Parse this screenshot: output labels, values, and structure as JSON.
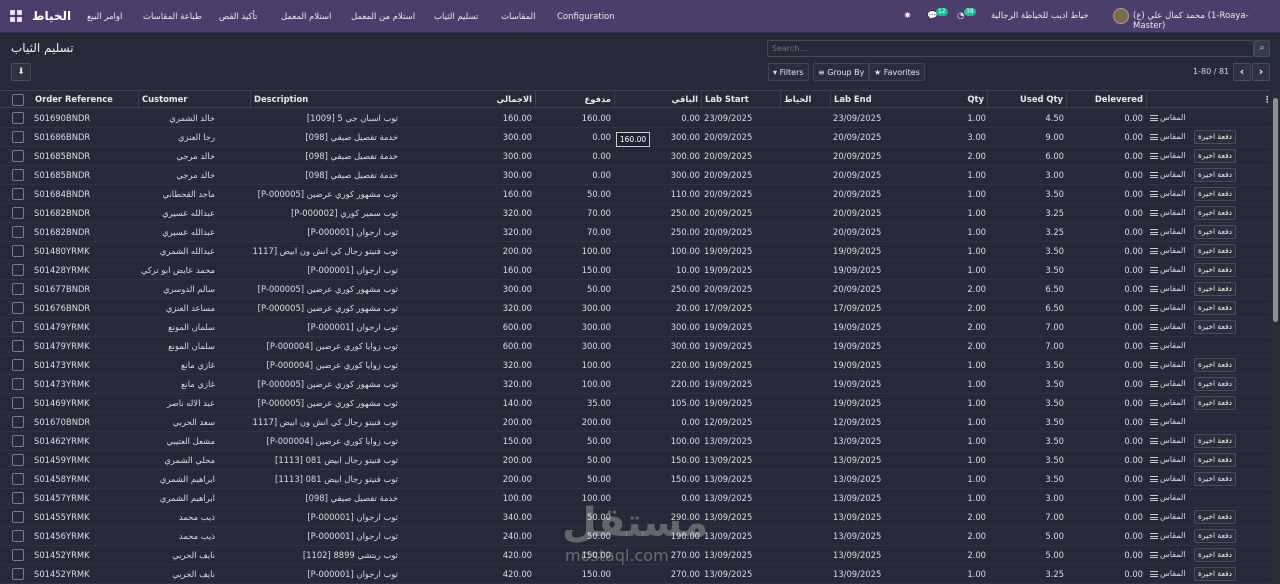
{
  "topbar": {
    "brand": "الخياط",
    "menu": [
      "اوامر البيع",
      "طباعة المقاسات",
      "تأكيد القص",
      "استلام المعمل",
      "استلام من المعمل",
      "تسليم الثياب",
      "المقاسات",
      "Configuration"
    ],
    "company": "خياط اديب للخياطة الرجالية",
    "user": "محمد كمال علي (ع) (1-Roaya-Master)",
    "chat_count": "12",
    "activity_count": "38",
    "icons": [
      "apps-icon",
      "bug-icon",
      "chat-icon",
      "clock-icon"
    ]
  },
  "page": {
    "title": "تسليم الثياب",
    "download_icon": "download-icon"
  },
  "search": {
    "placeholder": "Search...",
    "icon": "search-icon"
  },
  "filters": {
    "filters": "Filters",
    "group_by": "Group By",
    "favorites": "Favorites"
  },
  "pager": {
    "text": "1-80 / 81",
    "prev": "‹",
    "next": "›"
  },
  "tooltip": "160.00",
  "columns": {
    "order": "Order Reference",
    "customer": "Customer",
    "desc": "Description",
    "total": "الاجمالي",
    "paid": "مدفوع",
    "remain": "الباقي",
    "lab_start": "Lab Start",
    "tailor": "الخياط",
    "lab_end": "Lab End",
    "qty": "Qty",
    "used": "Used Qty",
    "delivered": "Delevered"
  },
  "labels": {
    "measure": "المقاس",
    "pay": "دفعة اخيرة"
  },
  "rows": [
    {
      "order": "S01690BNDR",
      "customer": "خالد الشمري",
      "desc": "ثوب اسبان جي 5 [1009]",
      "total": "160.00",
      "paid": "160.00",
      "remain": "0.00",
      "start": "23/09/2025",
      "end": "23/09/2025",
      "qty": "1.00",
      "used": "4.50",
      "deliv": "0.00",
      "pay": false
    },
    {
      "order": "S01686BNDR",
      "customer": "رجا العنزي",
      "desc": "خدمة تفصيل صيفي [098]",
      "total": "300.00",
      "paid": "0.00",
      "remain": "300.00",
      "start": "20/09/2025",
      "end": "20/09/2025",
      "qty": "3.00",
      "used": "9.00",
      "deliv": "0.00",
      "pay": true
    },
    {
      "order": "S01685BNDR",
      "customer": "خالد مرجي",
      "desc": "خدمة تفصيل صيفي [098]",
      "total": "300.00",
      "paid": "0.00",
      "remain": "300.00",
      "start": "20/09/2025",
      "end": "20/09/2025",
      "qty": "2.00",
      "used": "6.00",
      "deliv": "0.00",
      "pay": true
    },
    {
      "order": "S01685BNDR",
      "customer": "خالد مرجي",
      "desc": "خدمة تفصيل صيفي [098]",
      "total": "300.00",
      "paid": "0.00",
      "remain": "300.00",
      "start": "20/09/2025",
      "end": "20/09/2025",
      "qty": "1.00",
      "used": "3.00",
      "deliv": "0.00",
      "pay": true
    },
    {
      "order": "S01684BNDR",
      "customer": "ماجد القحطاني",
      "desc": "ثوب مشهور كوري عرضين [P-000005]",
      "total": "160.00",
      "paid": "50.00",
      "remain": "110.00",
      "start": "20/09/2025",
      "end": "20/09/2025",
      "qty": "1.00",
      "used": "3.50",
      "deliv": "0.00",
      "pay": true
    },
    {
      "order": "S01682BNDR",
      "customer": "عبدالله عسيري",
      "desc": "ثوب سمير كوري [P-000002]",
      "total": "320.00",
      "paid": "70.00",
      "remain": "250.00",
      "start": "20/09/2025",
      "end": "20/09/2025",
      "qty": "1.00",
      "used": "3.25",
      "deliv": "0.00",
      "pay": true
    },
    {
      "order": "S01682BNDR",
      "customer": "عبدالله عسيري",
      "desc": "ثوب ارجوان [P-000001]",
      "total": "320.00",
      "paid": "70.00",
      "remain": "250.00",
      "start": "20/09/2025",
      "end": "20/09/2025",
      "qty": "1.00",
      "used": "3.25",
      "deliv": "0.00",
      "pay": true
    },
    {
      "order": "S01480YRMK",
      "customer": "عبدالله الشمري",
      "desc": "ثوب فنيتو رجال كي انش ون ابيض [1117]",
      "total": "200.00",
      "paid": "100.00",
      "remain": "100.00",
      "start": "19/09/2025",
      "end": "19/09/2025",
      "qty": "1.00",
      "used": "3.50",
      "deliv": "0.00",
      "pay": true
    },
    {
      "order": "S01428YRMK",
      "customer": "محمد عايض ابو تركي",
      "desc": "ثوب ارجوان [P-000001]",
      "total": "160.00",
      "paid": "150.00",
      "remain": "10.00",
      "start": "19/09/2025",
      "end": "19/09/2025",
      "qty": "1.00",
      "used": "3.50",
      "deliv": "0.00",
      "pay": true
    },
    {
      "order": "S01677BNDR",
      "customer": "سالم الدوسري",
      "desc": "ثوب مشهور كوري عرضين [P-000005]",
      "total": "300.00",
      "paid": "50.00",
      "remain": "250.00",
      "start": "20/09/2025",
      "end": "20/09/2025",
      "qty": "2.00",
      "used": "6.50",
      "deliv": "0.00",
      "pay": true
    },
    {
      "order": "S01676BNDR",
      "customer": "مساعد العنزي",
      "desc": "ثوب مشهور كوري عرضين [P-000005]",
      "total": "320.00",
      "paid": "300.00",
      "remain": "20.00",
      "start": "17/09/2025",
      "end": "17/09/2025",
      "qty": "2.00",
      "used": "6.50",
      "deliv": "0.00",
      "pay": true
    },
    {
      "order": "S01479YRMK",
      "customer": "سلمان المونع",
      "desc": "ثوب ارجوان [P-000001]",
      "total": "600.00",
      "paid": "300.00",
      "remain": "300.00",
      "start": "19/09/2025",
      "end": "19/09/2025",
      "qty": "2.00",
      "used": "7.00",
      "deliv": "0.00",
      "pay": true
    },
    {
      "order": "S01479YRMK",
      "customer": "سلمان المونع",
      "desc": "ثوب زوايا كوري عرضين [P-000004]",
      "total": "600.00",
      "paid": "300.00",
      "remain": "300.00",
      "start": "19/09/2025",
      "end": "19/09/2025",
      "qty": "2.00",
      "used": "7.00",
      "deliv": "0.00",
      "pay": false
    },
    {
      "order": "S01473YRMK",
      "customer": "غازي مانع",
      "desc": "ثوب زوايا كوري عرضين [P-000004]",
      "total": "320.00",
      "paid": "100.00",
      "remain": "220.00",
      "start": "19/09/2025",
      "end": "19/09/2025",
      "qty": "1.00",
      "used": "3.50",
      "deliv": "0.00",
      "pay": true
    },
    {
      "order": "S01473YRMK",
      "customer": "غازي مانع",
      "desc": "ثوب مشهور كوري عرضين [P-000005]",
      "total": "320.00",
      "paid": "100.00",
      "remain": "220.00",
      "start": "19/09/2025",
      "end": "19/09/2025",
      "qty": "1.00",
      "used": "3.50",
      "deliv": "0.00",
      "pay": true
    },
    {
      "order": "S01469YRMK",
      "customer": "عبد الاله ناصر",
      "desc": "ثوب مشهور كوري عرضين [P-000005]",
      "total": "140.00",
      "paid": "35.00",
      "remain": "105.00",
      "start": "19/09/2025",
      "end": "19/09/2025",
      "qty": "1.00",
      "used": "3.50",
      "deliv": "0.00",
      "pay": true
    },
    {
      "order": "S01670BNDR",
      "customer": "سعد الحربي",
      "desc": "ثوب فنيتو رجال كي انش ون ابيض [1117]",
      "total": "200.00",
      "paid": "200.00",
      "remain": "0.00",
      "start": "12/09/2025",
      "end": "12/09/2025",
      "qty": "1.00",
      "used": "3.50",
      "deliv": "0.00",
      "pay": false
    },
    {
      "order": "S01462YRMK",
      "customer": "مشعل العتيبي",
      "desc": "ثوب زوايا كوري عرضين [P-000004]",
      "total": "150.00",
      "paid": "50.00",
      "remain": "100.00",
      "start": "13/09/2025",
      "end": "13/09/2025",
      "qty": "1.00",
      "used": "3.50",
      "deliv": "0.00",
      "pay": true
    },
    {
      "order": "S01459YRMK",
      "customer": "محلي الشمري",
      "desc": "ثوب فنيتو رجال ابيض 081 [1113]",
      "total": "200.00",
      "paid": "50.00",
      "remain": "150.00",
      "start": "13/09/2025",
      "end": "13/09/2025",
      "qty": "1.00",
      "used": "3.50",
      "deliv": "0.00",
      "pay": true
    },
    {
      "order": "S01458YRMK",
      "customer": "ابراهيم الشمري",
      "desc": "ثوب فنيتو رجال ابيض 081 [1113]",
      "total": "200.00",
      "paid": "50.00",
      "remain": "150.00",
      "start": "13/09/2025",
      "end": "13/09/2025",
      "qty": "1.00",
      "used": "3.50",
      "deliv": "0.00",
      "pay": true
    },
    {
      "order": "S01457YRMK",
      "customer": "ابراهيم الشمري",
      "desc": "خدمة تفصيل صيفي [098]",
      "total": "100.00",
      "paid": "100.00",
      "remain": "0.00",
      "start": "13/09/2025",
      "end": "13/09/2025",
      "qty": "1.00",
      "used": "3.00",
      "deliv": "0.00",
      "pay": false
    },
    {
      "order": "S01455YRMK",
      "customer": "ذيب محمد",
      "desc": "ثوب ارجوان [P-000001]",
      "total": "340.00",
      "paid": "50.00",
      "remain": "290.00",
      "start": "13/09/2025",
      "end": "13/09/2025",
      "qty": "2.00",
      "used": "7.00",
      "deliv": "0.00",
      "pay": true
    },
    {
      "order": "S01456YRMK",
      "customer": "ذيب محمد",
      "desc": "ثوب ارجوان [P-000001]",
      "total": "240.00",
      "paid": "50.00",
      "remain": "190.00",
      "start": "13/09/2025",
      "end": "13/09/2025",
      "qty": "2.00",
      "used": "5.00",
      "deliv": "0.00",
      "pay": true
    },
    {
      "order": "S01452YRMK",
      "customer": "نايف الحربي",
      "desc": "ثوب ريتشي 8899 [1102]",
      "total": "420.00",
      "paid": "150.00",
      "remain": "270.00",
      "start": "13/09/2025",
      "end": "13/09/2025",
      "qty": "2.00",
      "used": "5.00",
      "deliv": "0.00",
      "pay": true
    },
    {
      "order": "S01452YRMK",
      "customer": "نايف الحربي",
      "desc": "ثوب ارجوان [P-000001]",
      "total": "420.00",
      "paid": "150.00",
      "remain": "270.00",
      "start": "13/09/2025",
      "end": "13/09/2025",
      "qty": "1.00",
      "used": "3.25",
      "deliv": "0.00",
      "pay": true
    }
  ],
  "watermark": {
    "ar": "مستقل",
    "en": "mostaql.com"
  }
}
